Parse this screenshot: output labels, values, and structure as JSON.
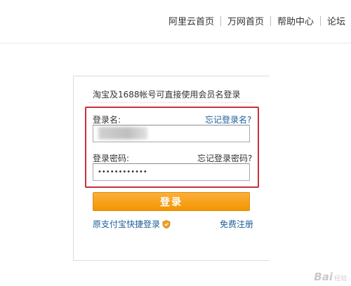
{
  "nav": {
    "items": [
      "阿里云首页",
      "万网首页",
      "帮助中心",
      "论坛"
    ]
  },
  "login": {
    "hint": "淘宝及1688帐号可直接使用会员名登录",
    "username_label": "登录名:",
    "forgot_username": "忘记登录名?",
    "password_label": "登录密码:",
    "forgot_password": "忘记登录密码?",
    "password_value": "••••••••••••",
    "submit_label": "登录",
    "alipay_link": "原支付宝快捷登录",
    "register_link": "免费注册"
  },
  "watermark": {
    "text": "Bai",
    "suffix": "经验"
  },
  "colors": {
    "link": "#1e5e99",
    "highlight": "#c8303d",
    "button": "#f39500"
  }
}
